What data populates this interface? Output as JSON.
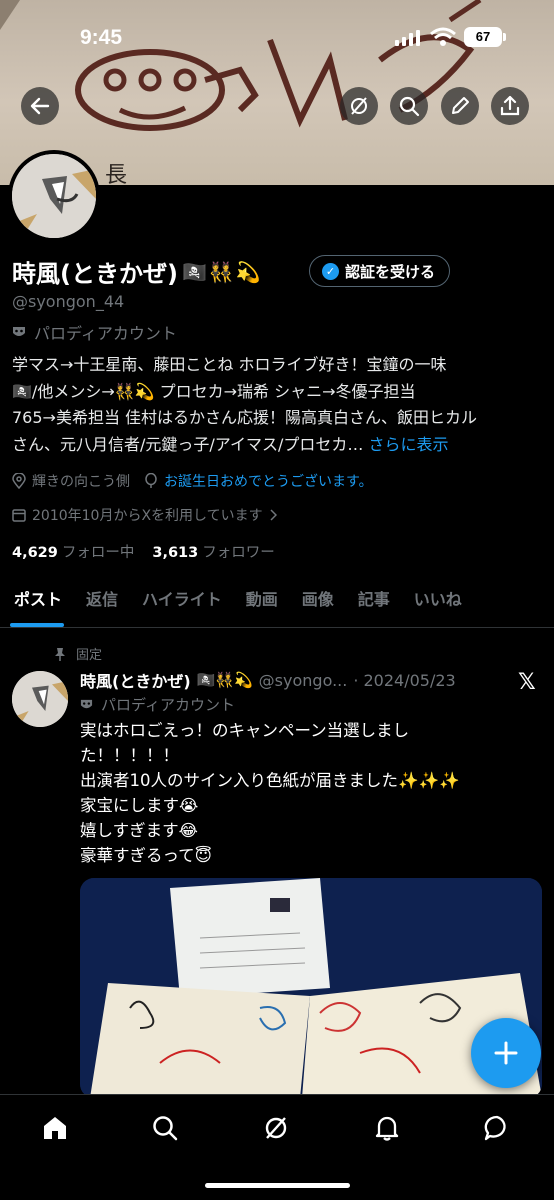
{
  "status_bar": {
    "time": "9:45",
    "battery": "67"
  },
  "header": {
    "back": "back-arrow-icon",
    "actions": [
      "grok-icon",
      "search-icon",
      "edit-icon",
      "share-icon"
    ]
  },
  "banner": {
    "text": "長"
  },
  "profile": {
    "display_name": "時風(ときかぜ)",
    "name_emojis": "🏴‍☠️👯💫",
    "verify_label": "認証を受ける",
    "handle": "@syongon_44",
    "parody_label": "パロディアカウント",
    "bio_lines": [
      "学マス→十王星南、藤田ことね ホロライブ好き！宝鐘の一味",
      "🏴‍☠️/他メンシ→👯💫 プロセカ→瑞希 シャニ→冬優子担当",
      "765→美希担当 佳村はるかさん応援！陽高真白さん、飯田ヒカル"
    ],
    "bio_last_line": "さん、元八月信者/元鍵っ子/アイマス/プロセカ…",
    "bio_more": "さらに表示",
    "location": "輝きの向こう側",
    "website": "お誕生日おめでとうございます。",
    "joined": "2010年10月からXを利用しています",
    "following_count": "4,629",
    "following_label": "フォロー中",
    "followers_count": "3,613",
    "followers_label": "フォロワー"
  },
  "tabs": [
    {
      "label": "ポスト",
      "active": true
    },
    {
      "label": "返信"
    },
    {
      "label": "ハイライト"
    },
    {
      "label": "動画"
    },
    {
      "label": "画像"
    },
    {
      "label": "記事"
    },
    {
      "label": "いいね"
    }
  ],
  "post": {
    "pinned_label": "固定",
    "name": "時風(ときかぜ)",
    "name_emojis": "🏴‍☠️👯💫",
    "handle": "@syongo...",
    "date": "· 2024/05/23",
    "parody_label": "パロディアカウント",
    "lines": [
      "実はホロごえっ！のキャンペーン当選しまし",
      "た！！！！！",
      "出演者10人のサイン入り色紙が届きました✨✨✨",
      "家宝にします😭",
      "嬉しすぎます😂",
      "豪華すぎるって😇"
    ]
  },
  "nav": [
    "home-icon",
    "search-icon",
    "grok-icon",
    "notifications-icon",
    "messages-icon"
  ],
  "colors": {
    "accent": "#1d9bf0",
    "background": "#000000",
    "muted": "#71767b"
  }
}
